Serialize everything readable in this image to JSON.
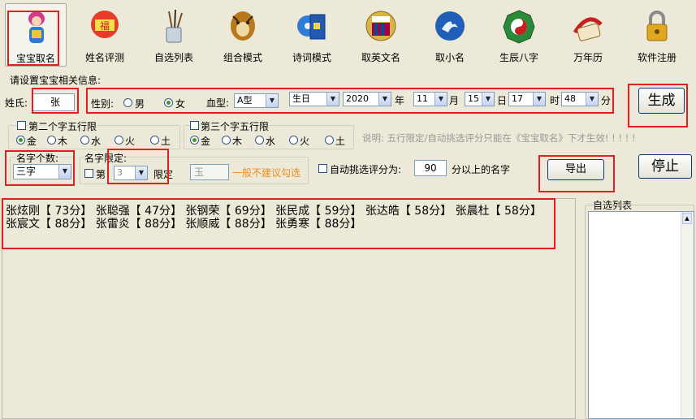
{
  "toolbar": [
    {
      "label": "宝宝取名",
      "icon": "baby-icon"
    },
    {
      "label": "姓名评测",
      "icon": "fu-lantern-icon"
    },
    {
      "label": "自选列表",
      "icon": "brush-pot-icon"
    },
    {
      "label": "组合模式",
      "icon": "tiger-icon"
    },
    {
      "label": "诗词模式",
      "icon": "book-disc-icon"
    },
    {
      "label": "取英文名",
      "icon": "barcelona-badge-icon"
    },
    {
      "label": "取小名",
      "icon": "bird-orb-icon"
    },
    {
      "label": "生辰八字",
      "icon": "bagua-icon"
    },
    {
      "label": "万年历",
      "icon": "calendar-scroll-icon"
    },
    {
      "label": "软件注册",
      "icon": "lock-icon"
    }
  ],
  "form": {
    "section_title": "请设置宝宝相关信息:",
    "surname_label": "姓氏:",
    "surname_value": "张",
    "gender_label": "性别:",
    "male": "男",
    "female": "女",
    "blood_label": "血型:",
    "blood_value": "A型",
    "date_type": "生日",
    "year": "2020",
    "year_unit": "年",
    "month": "11",
    "month_unit": "月",
    "day": "15",
    "day_unit": "日",
    "hour": "17",
    "hour_unit": "时",
    "minute": "48",
    "minute_unit": "分",
    "generate": "生成",
    "second_char_limit": "第二个字五行限",
    "third_char_limit": "第三个字五行限",
    "elements": [
      "金",
      "木",
      "水",
      "火",
      "土"
    ],
    "note": "说明: 五行限定/自动挑选评分只能在《宝宝取名》下才生效! ! ! ! !",
    "name_count_label": "名字个数:",
    "name_count_value": "三字",
    "name_limit_label": "名字限定:",
    "limit_prefix": "第",
    "limit_position": "3",
    "limit_suffix": "限定",
    "limit_char": "玉",
    "limit_hint": "一般不建议勾选",
    "auto_score_label": "自动挑选评分为:",
    "auto_score_value": "90",
    "auto_score_suffix": "分以上的名字",
    "export": "导出",
    "stop": "停止"
  },
  "results": {
    "line1": "张炫刚【 73分】 张聪强【 47分】 张钢荣【 69分】 张民成【 59分】 张达皓【 58分】 张晨杜【 58分】",
    "line2": "张宸文【 88分】 张雷炎【 88分】 张顺威【 88分】 张勇寒【 88分】"
  },
  "custom_list": {
    "title": "自选列表"
  }
}
